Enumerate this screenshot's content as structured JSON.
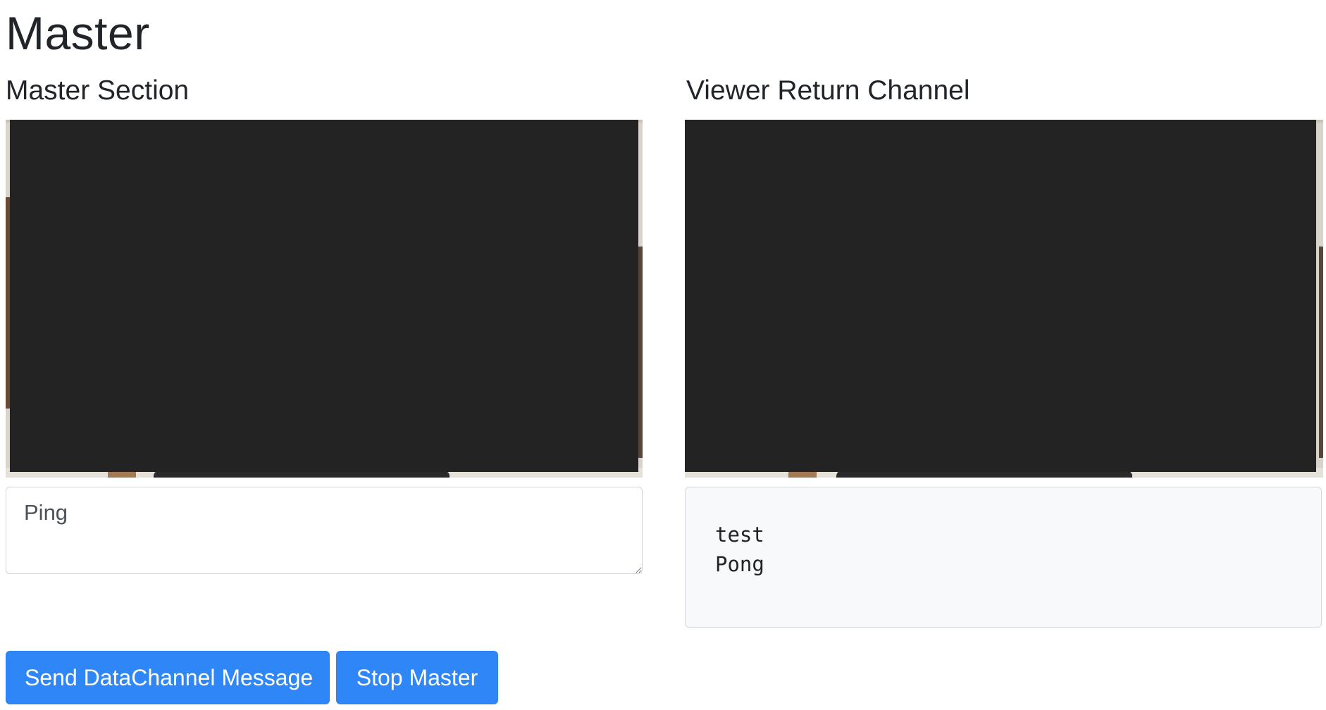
{
  "page": {
    "title": "Master"
  },
  "master_section": {
    "heading": "Master Section",
    "message_input_value": "Ping"
  },
  "viewer_section": {
    "heading": "Viewer Return Channel",
    "messages": [
      "test",
      "Pong"
    ]
  },
  "actions": {
    "send_label": "Send DataChannel Message",
    "stop_label": "Stop Master"
  },
  "colors": {
    "primary_button": "#2f86f6",
    "redaction": "#232323",
    "return_channel_bg": "#f8f9fa"
  }
}
